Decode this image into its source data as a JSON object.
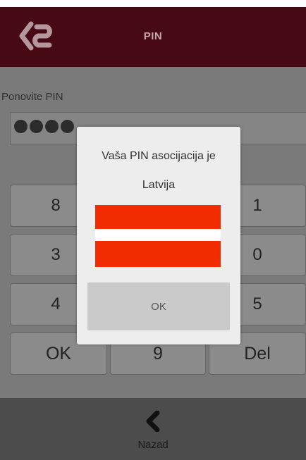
{
  "header": {
    "title": "PIN",
    "logo_icon": "logo-icon"
  },
  "form": {
    "label": "Ponovite PIN",
    "entered_digits": 4
  },
  "keypad": {
    "keys": [
      "8",
      "1",
      "3",
      "0",
      "4",
      "5",
      "OK",
      "9",
      "Del"
    ]
  },
  "footer": {
    "back_icon": "chevron-left-icon",
    "back_label": "Nazad"
  },
  "dialog": {
    "message": "Vaša PIN asocijacija je",
    "country": "Latvija",
    "flag_colors": [
      "#f12c00",
      "#ffffff",
      "#f12c00"
    ],
    "ok_label": "OK"
  },
  "colors": {
    "header_bg": "#470a14",
    "overlay_bg": "#7a7a7a",
    "footer_bg": "#4c4c4c",
    "dialog_bg": "#ededed"
  }
}
